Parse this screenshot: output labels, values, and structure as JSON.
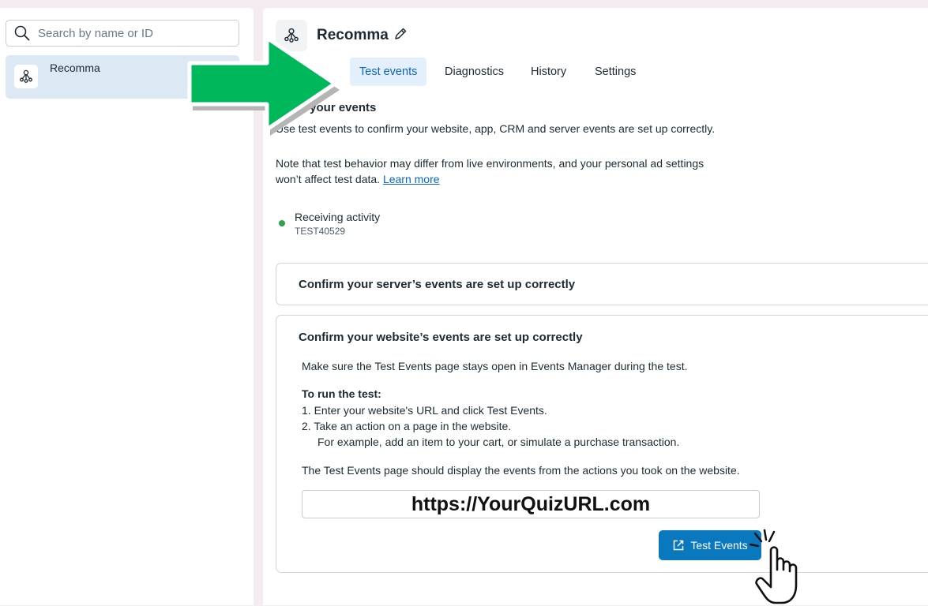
{
  "sidebar": {
    "search_placeholder": "Search by name or ID",
    "items": [
      {
        "label": "Recomma",
        "icon": "pixel-node-icon"
      }
    ]
  },
  "header": {
    "title": "Recomma",
    "edit_icon": "pencil-icon"
  },
  "tabs": [
    {
      "label": "Test events",
      "active": true
    },
    {
      "label": "Diagnostics",
      "active": false
    },
    {
      "label": "History",
      "active": false
    },
    {
      "label": "Settings",
      "active": false
    }
  ],
  "main": {
    "section_title": "t your events",
    "desc1": "Use test events to confirm your website, app, CRM and server events are set up correctly.",
    "desc2_line1": "Note that test behavior may differ from live environments, and your personal ad settings",
    "desc2_line2": "won’t affect test data.",
    "learn_more": "Learn more",
    "status_label": "Receiving activity",
    "status_code": "TEST40529",
    "status_color": "#31a24c"
  },
  "server_card": {
    "title": "Confirm your server’s events are set up correctly"
  },
  "website_card": {
    "title": "Confirm your website’s events are set up correctly",
    "intro": "Make sure the Test Events page stays open in Events Manager during the test.",
    "run_heading": "To run the test:",
    "step1": "1.  Enter your website's URL and click Test Events.",
    "step2": "2.  Take an action on a page in the website.",
    "step2_example": "For example, add an item to your cart, or simulate a purchase transaction.",
    "result_text": "The Test Events page should display the events from the actions you took on the website.",
    "url_value": "https://YourQuizURL.com",
    "button_label": "Test Events",
    "button_icon": "external-link-icon",
    "button_color": "#0a78be"
  },
  "overlays": {
    "arrow_color": "#00b85c",
    "arrow_icon": "green-arrow-icon",
    "cursor_icon": "pointing-hand-icon"
  }
}
